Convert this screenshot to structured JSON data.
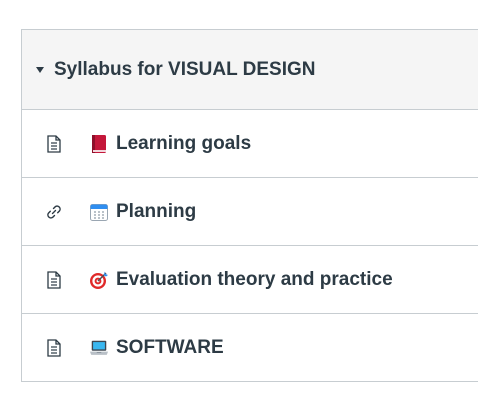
{
  "module": {
    "title": "Syllabus for VISUAL DESIGN",
    "items": [
      {
        "type_icon": "page-icon",
        "emoji": "closed-book-icon",
        "title": "Learning goals"
      },
      {
        "type_icon": "link-icon",
        "emoji": "calendar-icon",
        "title": "Planning"
      },
      {
        "type_icon": "page-icon",
        "emoji": "dart-target-icon",
        "title": "Evaluation theory and practice"
      },
      {
        "type_icon": "page-icon",
        "emoji": "laptop-icon",
        "title": "SOFTWARE"
      }
    ]
  },
  "colors": {
    "header_bg": "#f5f5f5",
    "border": "#c7cdd1",
    "text": "#2d3b45"
  }
}
